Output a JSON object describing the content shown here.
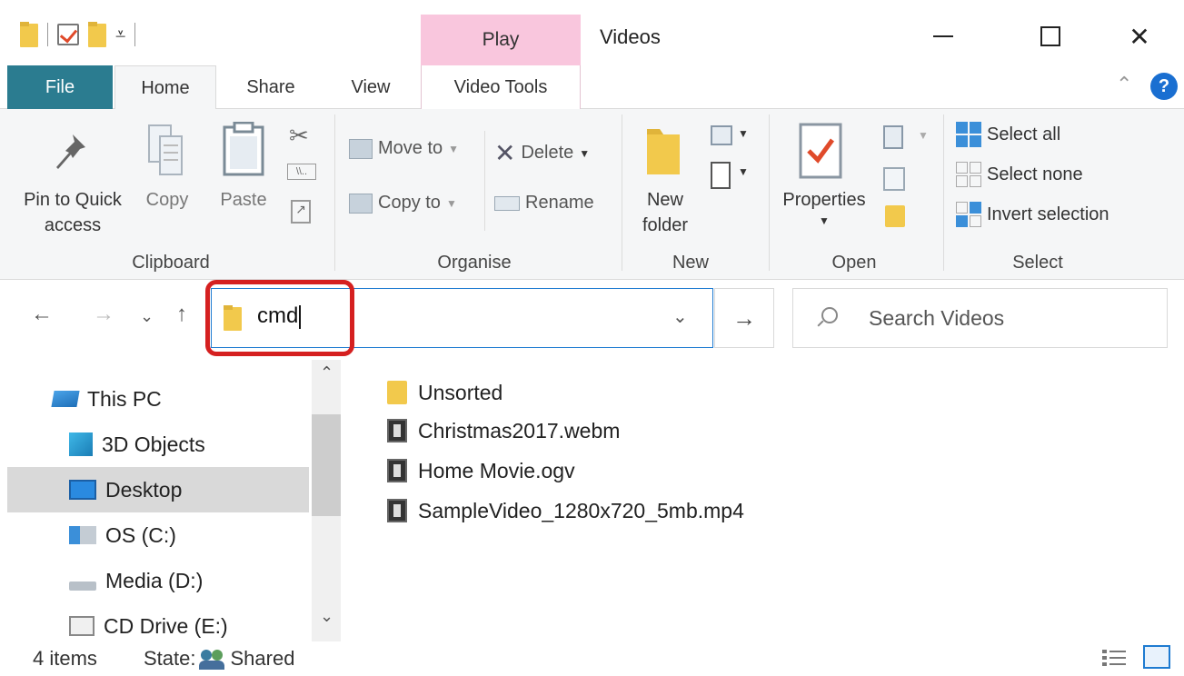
{
  "window": {
    "title": "Videos",
    "contextual_tab": "Play",
    "controls": {
      "minimize": "—",
      "maximize": "☐",
      "close": "✕"
    }
  },
  "tabs": [
    {
      "label": "File"
    },
    {
      "label": "Home"
    },
    {
      "label": "Share"
    },
    {
      "label": "View"
    },
    {
      "label": "Video Tools"
    }
  ],
  "ribbon": {
    "clipboard": {
      "label": "Clipboard",
      "pin_line1": "Pin to Quick",
      "pin_line2": "access",
      "copy": "Copy",
      "paste": "Paste"
    },
    "organise": {
      "label": "Organise",
      "move_to": "Move to",
      "copy_to": "Copy to",
      "delete": "Delete",
      "rename": "Rename"
    },
    "new": {
      "label": "New",
      "new_line1": "New",
      "new_line2": "folder"
    },
    "open": {
      "label": "Open",
      "properties": "Properties"
    },
    "select": {
      "label": "Select",
      "select_all": "Select all",
      "select_none": "Select none",
      "invert_selection": "Invert selection"
    }
  },
  "address": {
    "value": "cmd",
    "search_placeholder": "Search Videos"
  },
  "nav_pane": {
    "items": [
      {
        "label": "This PC",
        "icon": "computer-icon"
      },
      {
        "label": "3D Objects",
        "icon": "cube-icon"
      },
      {
        "label": "Desktop",
        "icon": "desktop-icon",
        "selected": true
      },
      {
        "label": "OS (C:)",
        "icon": "os-drive-icon"
      },
      {
        "label": "Media (D:)",
        "icon": "drive-icon"
      },
      {
        "label": "CD Drive (E:)",
        "icon": "cd-drive-icon"
      }
    ]
  },
  "files": [
    {
      "name": "Unsorted",
      "icon": "folder-icon"
    },
    {
      "name": "Christmas2017.webm",
      "icon": "video-file-icon"
    },
    {
      "name": "Home Movie.ogv",
      "icon": "video-file-icon"
    },
    {
      "name": "SampleVideo_1280x720_5mb.mp4",
      "icon": "video-file-icon"
    }
  ],
  "status": {
    "count": "4 items",
    "state_label": "State:",
    "state_value": "Shared"
  },
  "colors": {
    "file_tab": "#2b7c90",
    "contextual_tab": "#f9c6dd",
    "highlight": "#d52020",
    "address_border": "#1e7bd1"
  }
}
